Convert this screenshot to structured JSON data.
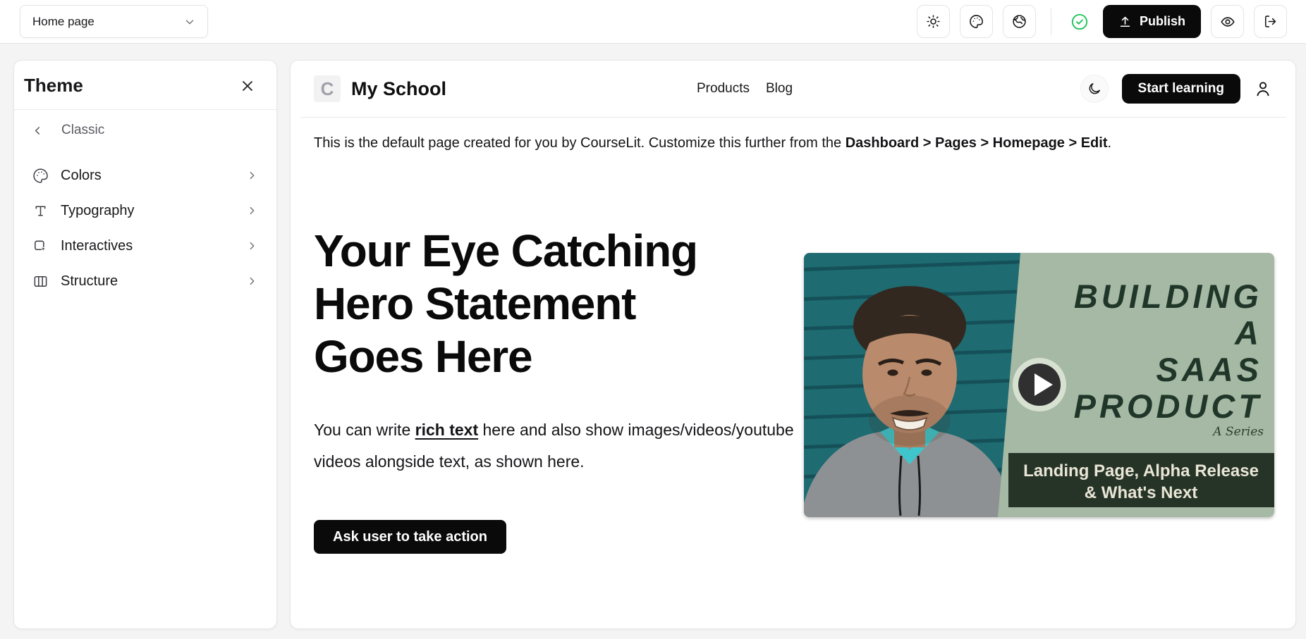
{
  "topbar": {
    "page_selector_value": "Home page",
    "publish_label": "Publish"
  },
  "theme_panel": {
    "title": "Theme",
    "theme_name": "Classic",
    "items": [
      {
        "label": "Colors",
        "icon": "palette-icon"
      },
      {
        "label": "Typography",
        "icon": "typography-icon"
      },
      {
        "label": "Interactives",
        "icon": "interactives-icon"
      },
      {
        "label": "Structure",
        "icon": "structure-icon"
      }
    ]
  },
  "preview": {
    "logo_letter": "C",
    "school_name": "My School",
    "nav": [
      {
        "label": "Products"
      },
      {
        "label": "Blog"
      }
    ],
    "start_learning_label": "Start learning",
    "notice_text": "This is the default page created for you by CourseLit. Customize this further from the ",
    "notice_bold": "Dashboard > Pages > Homepage > Edit",
    "notice_suffix": ".",
    "hero": {
      "heading_lines": [
        "Your Eye Catching",
        "Hero Statement",
        "Goes Here"
      ],
      "paragraph_pre": "You can write ",
      "paragraph_link": "rich text",
      "paragraph_post": " here and also show images/videos/youtube videos alongside text, as shown here.",
      "cta_label": "Ask user to take action"
    },
    "video": {
      "title_lines": [
        "BUILDING",
        "A",
        "SAAS",
        "PRODUCT"
      ],
      "series_label": "A Series",
      "banner_lines": [
        "Landing Page, Alpha Release",
        "& What's Next"
      ]
    }
  },
  "colors": {
    "publish_button": "#0a0a0a",
    "status_check": "#22c55e",
    "thumb_teal_wall": "#1e6b72",
    "thumb_sage": "#a6b9a4",
    "thumb_title_text": "#1f3629",
    "thumb_banner_bg": "#263428",
    "thumb_banner_text": "#e9e6d6"
  }
}
